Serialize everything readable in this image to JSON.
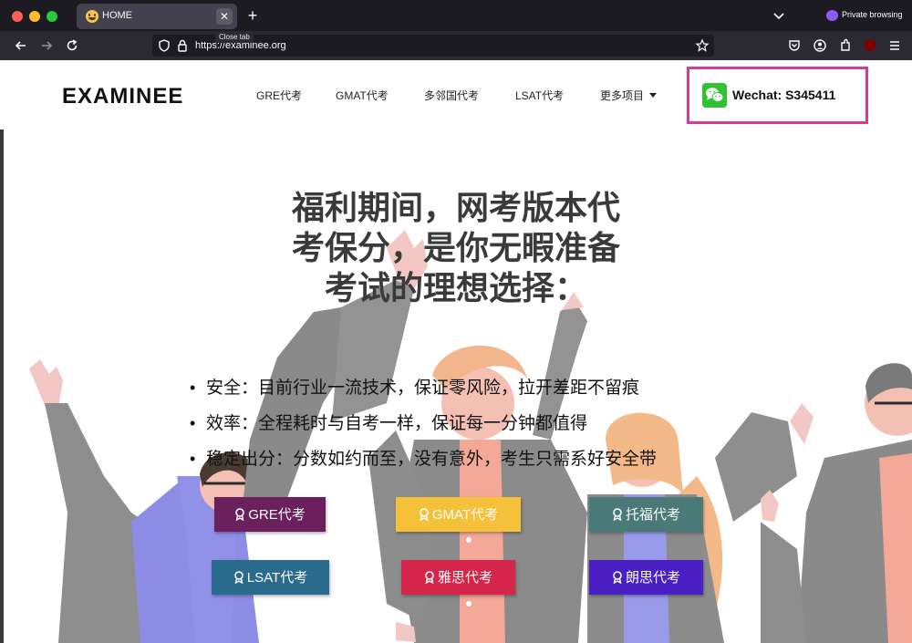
{
  "browser": {
    "tab_title": "HOME",
    "tab_close_tooltip": "Close tab",
    "new_tab": "+",
    "url": "https://examinee.org",
    "private_label": "Private browsing"
  },
  "site": {
    "logo": "EXAMINEE",
    "nav": [
      {
        "label": "GRE代考"
      },
      {
        "label": "GMAT代考"
      },
      {
        "label": "多邻国代考"
      },
      {
        "label": "LSAT代考"
      },
      {
        "label": "更多项目"
      }
    ],
    "wechat": "Wechat: S345411",
    "accent_color": "#d9398f"
  },
  "hero": {
    "title_lines": [
      "福利期间，网考版本代",
      "考保分，是你无暇准备",
      "考试的理想选择："
    ],
    "bullets": [
      "安全：目前行业一流技术，保证零风险，拉开差距不留痕",
      "效率：全程耗时与自考一样，保证每一分钟都值得",
      "稳定出分：分数如约而至，没有意外，考生只需系好安全带"
    ],
    "buttons": [
      {
        "label": "GRE代考",
        "color": "#6b1f5c"
      },
      {
        "label": "GMAT代考",
        "color": "#f5c13a"
      },
      {
        "label": "托福代考",
        "color": "#4a7a78"
      },
      {
        "label": "LSAT代考",
        "color": "#2a6a8c"
      },
      {
        "label": "雅思代考",
        "color": "#d5254a"
      },
      {
        "label": "朗思代考",
        "color": "#4a1fc4"
      }
    ]
  }
}
